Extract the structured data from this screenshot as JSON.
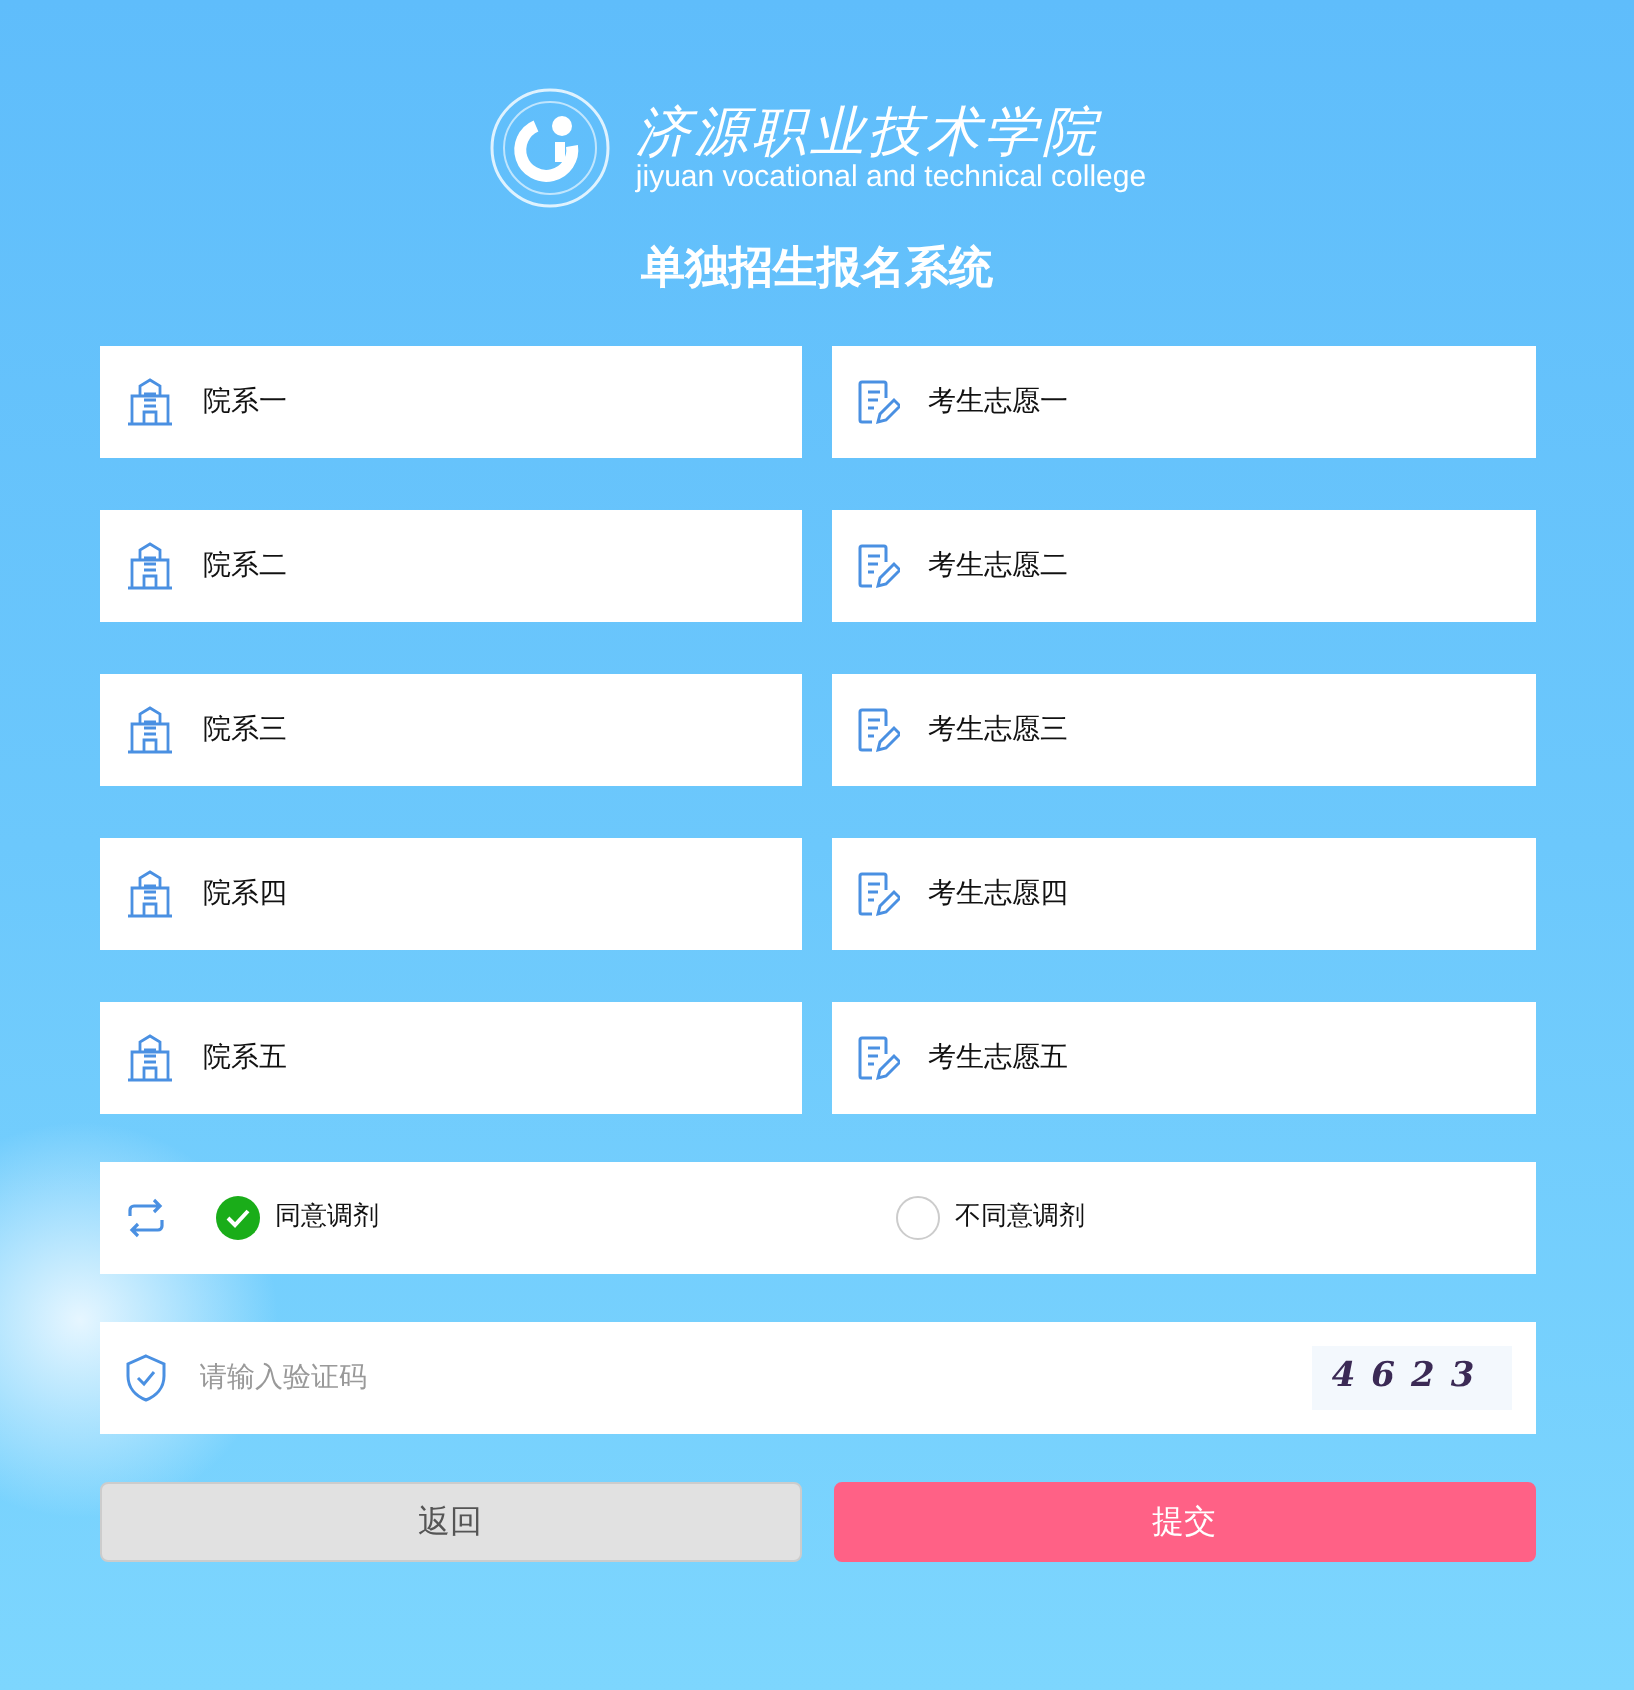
{
  "header": {
    "school_name": "济源职业技术学院",
    "school_name_en": "jiyuan vocational and technical college",
    "title": "单独招生报名系统"
  },
  "choices": [
    {
      "department": "院系一",
      "wish": "考生志愿一"
    },
    {
      "department": "院系二",
      "wish": "考生志愿二"
    },
    {
      "department": "院系三",
      "wish": "考生志愿三"
    },
    {
      "department": "院系四",
      "wish": "考生志愿四"
    },
    {
      "department": "院系五",
      "wish": "考生志愿五"
    }
  ],
  "adjustment": [
    {
      "label": "同意调剂",
      "selected": true
    },
    {
      "label": "不同意调剂",
      "selected": false
    }
  ],
  "captcha": {
    "placeholder": "请输入验证码",
    "code": "4623"
  },
  "buttons": [
    {
      "label": "返回",
      "kind": "secondary"
    },
    {
      "label": "提交",
      "kind": "primary"
    }
  ]
}
